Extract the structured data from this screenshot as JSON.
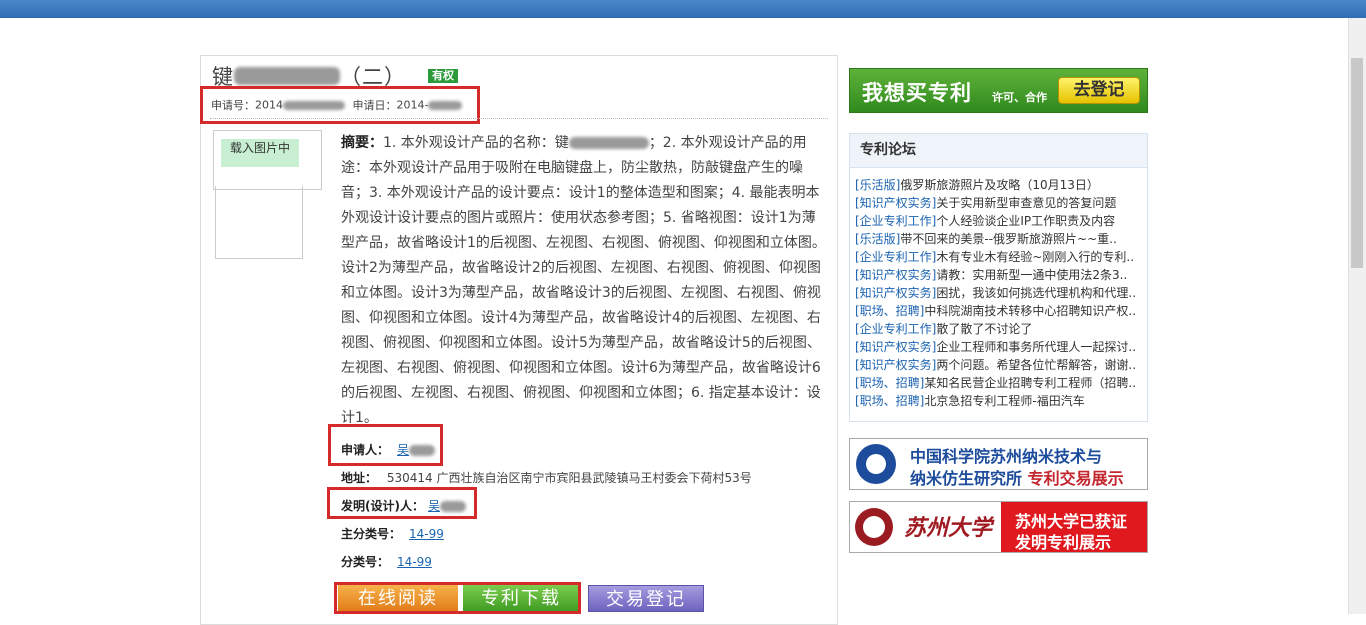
{
  "header": {},
  "patent": {
    "title_prefix": "键",
    "title_suffix": "（二）",
    "status_badge": "有权",
    "application_no_label": "申请号：",
    "application_no_value": "2014",
    "application_date_label": "申请日：",
    "application_date_value": "2014-",
    "image_loading": "载入图片中",
    "abstract_label": "摘要：",
    "abstract_text_1": "1. 本外观设计产品的名称：键",
    "abstract_text_2": "；2. 本外观设计产品的用途：本外观设计产品用于吸附在电脑键盘上，防尘散热，防敲键盘产生的噪音；3. 本外观设计产品的设计要点：设计1的整体造型和图案；4. 最能表明本外观设计设计要点的图片或照片：使用状态参考图；5. 省略视图：设计1为薄型产品，故省略设计1的后视图、左视图、右视图、俯视图、仰视图和立体图。设计2为薄型产品，故省略设计2的后视图、左视图、右视图、俯视图、仰视图和立体图。设计3为薄型产品，故省略设计3的后视图、左视图、右视图、俯视图、仰视图和立体图。设计4为薄型产品，故省略设计4的后视图、左视图、右视图、俯视图、仰视图和立体图。设计5为薄型产品，故省略设计5的后视图、左视图、右视图、俯视图、仰视图和立体图。设计6为薄型产品，故省略设计6的后视图、左视图、右视图、俯视图、仰视图和立体图；6. 指定基本设计：设计1。",
    "applicant_label": "申请人：",
    "applicant_value": "吴",
    "address_label": "地址：",
    "address_value": "530414 广西壮族自治区南宁市宾阳县武陵镇马王村委会下荷村53号",
    "inventor_label": "发明(设计)人：",
    "inventor_value": "吴",
    "main_class_label": "主分类号：",
    "main_class_value": "14-99",
    "class_label": "分类号：",
    "class_value": "14-99"
  },
  "buttons": {
    "read": "在线阅读",
    "download": "专利下载",
    "trade": "交易登记"
  },
  "sidebar": {
    "buy_big": "我想买专利",
    "buy_small": "许可、合作",
    "buy_register": "去登记",
    "forum_title": "专利论坛",
    "forum_items": [
      {
        "cat": "[乐活版]",
        "text": "俄罗斯旅游照片及攻略（10月13日）"
      },
      {
        "cat": "[知识产权实务]",
        "text": "关于实用新型审查意见的答复问题"
      },
      {
        "cat": "[企业专利工作]",
        "text": "个人经验谈企业IP工作职责及内容"
      },
      {
        "cat": "[乐活版]",
        "text": "带不回来的美景--俄罗斯旅游照片~~重.."
      },
      {
        "cat": "[企业专利工作]",
        "text": "木有专业木有经验~刚刚入行的专利.."
      },
      {
        "cat": "[知识产权实务]",
        "text": "请教：实用新型一通中使用法2条3.."
      },
      {
        "cat": "[知识产权实务]",
        "text": "困扰，我该如何挑选代理机构和代理.."
      },
      {
        "cat": "[职场、招聘]",
        "text": "中科院湖南技术转移中心招聘知识产权.."
      },
      {
        "cat": "[企业专利工作]",
        "text": "散了散了不讨论了"
      },
      {
        "cat": "[知识产权实务]",
        "text": "企业工程师和事务所代理人一起探讨.."
      },
      {
        "cat": "[知识产权实务]",
        "text": "两个问题。希望各位忙帮解答，谢谢.."
      },
      {
        "cat": "[职场、招聘]",
        "text": "某知名民营企业招聘专利工程师（招聘.."
      },
      {
        "cat": "[职场、招聘]",
        "text": "北京急招专利工程师-福田汽车"
      }
    ],
    "banner1_line1": "中国科学院苏州纳米技术与",
    "banner1_line2a": "纳米仿生研究所",
    "banner1_line2b": "专利交易展示",
    "banner2_name": "苏州大学",
    "banner2_line1": "苏州大学已获证",
    "banner2_line2": "发明专利展示"
  }
}
